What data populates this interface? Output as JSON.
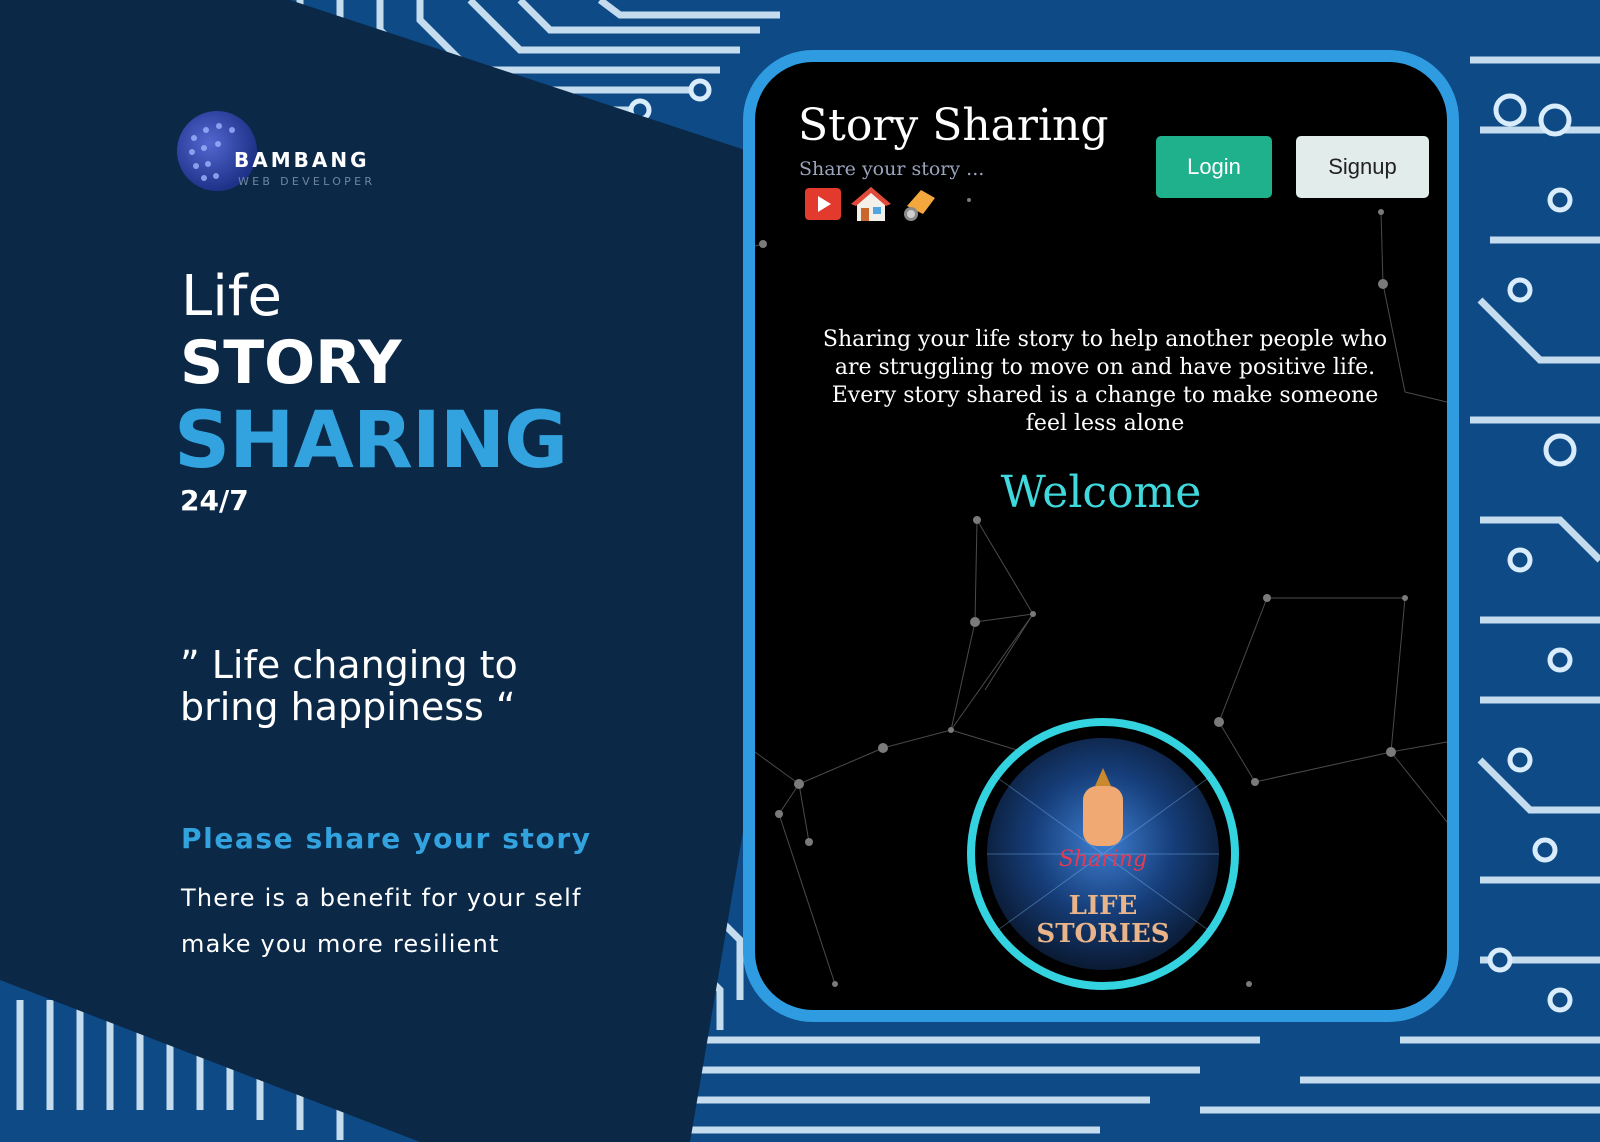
{
  "brand": {
    "name": "BAMBANG",
    "tagline": "WEB DEVELOPER"
  },
  "hero": {
    "line1": "Life",
    "line2": "STORY",
    "line3": "SHARING",
    "line4": "24/7"
  },
  "quote": "” Life changing to bring happiness “",
  "cta": {
    "heading": "Please share your story",
    "body": "There is a benefit for your self make you more resilient"
  },
  "app": {
    "title": "Story Sharing",
    "subtitle": "Share your story ...",
    "icons": [
      "youtube-icon",
      "home-icon",
      "pay-icon"
    ],
    "login_label": "Login",
    "signup_label": "Signup",
    "intro": "Sharing your life story to help another people who are struggling to move on and have positive life. Every story shared is a change to make someone feel less alone",
    "welcome": "Welcome",
    "badge": {
      "script_text": "Sharing",
      "line1": "LIFE",
      "line2": "STORIES"
    }
  },
  "colors": {
    "navy": "#0b2a47",
    "accent_blue": "#33a3e0",
    "device_border": "#2f9be0",
    "login_green": "#1fb08c",
    "welcome_cyan": "#3fd8dc"
  }
}
